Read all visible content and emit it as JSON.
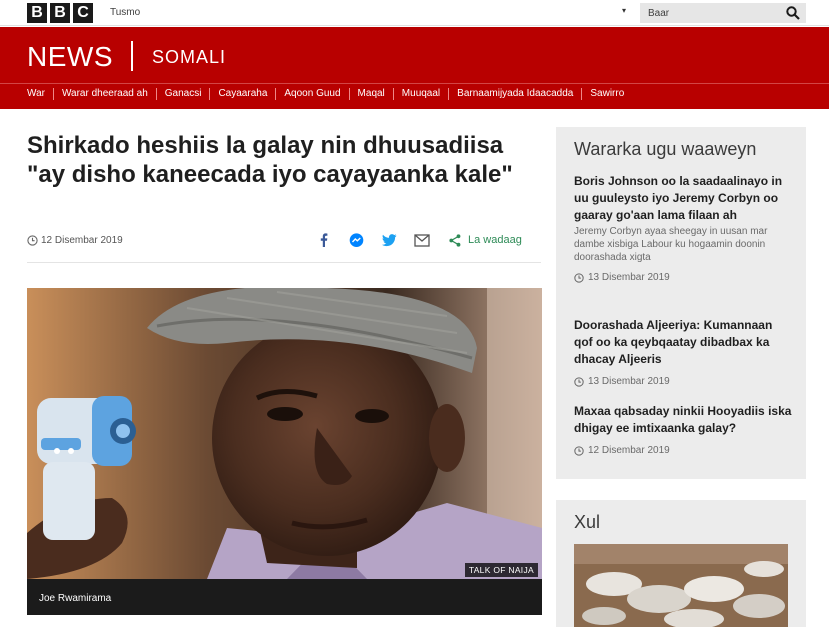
{
  "brand": {
    "bbc_letters": [
      "B",
      "B",
      "C"
    ],
    "news": "NEWS",
    "service": "SOMALI"
  },
  "topbar": {
    "menu_label": "Tusmo",
    "menu_caret": "▾",
    "search_placeholder": "Baar"
  },
  "nav": {
    "items": [
      "War",
      "Warar dheeraad ah",
      "Ganacsi",
      "Cayaaraha",
      "Aqoon Guud",
      "Maqal",
      "Muuqaal",
      "Barnaamijyada Idaacadda",
      "Sawirro"
    ]
  },
  "article": {
    "headline": "Shirkado heshiis la galay nin dhuusadiisa \"ay disho kaneecada iyo cayayaanka kale\"",
    "date": "12 Disembar 2019",
    "share_label": "La wadaag",
    "image_caption": "Joe Rwamirama",
    "image_credit": "TALK OF NAIJA"
  },
  "sidebar": {
    "title": "Wararka ugu waaweyn",
    "items": [
      {
        "title": "Boris Johnson oo la saadaalinayo in uu guuleysto iyo Jeremy Corbyn oo gaaray go'aan lama filaan ah",
        "summary": "Jeremy Corbyn ayaa sheegay in uusan mar dambe xisbiga Labour ku hogaamin doonin doorashada xigta",
        "date": "13 Disembar 2019"
      },
      {
        "title": "Doorashada Aljeeriya: Kumannaan qof oo ka qeybqaatay dibadbax ka dhacay Aljeeris",
        "date": "13 Disembar 2019"
      },
      {
        "title": "Maxaa qabsaday ninkii Hooyadiis iska dhigay ee imtixaanka galay?",
        "date": "12 Disembar 2019"
      }
    ]
  },
  "sidebar2": {
    "title": "Xul"
  },
  "colors": {
    "brand_red": "#b80000",
    "share_green": "#2e8b57",
    "facebook": "#3b5998",
    "messenger": "#0084ff",
    "twitter": "#1da1f2"
  }
}
